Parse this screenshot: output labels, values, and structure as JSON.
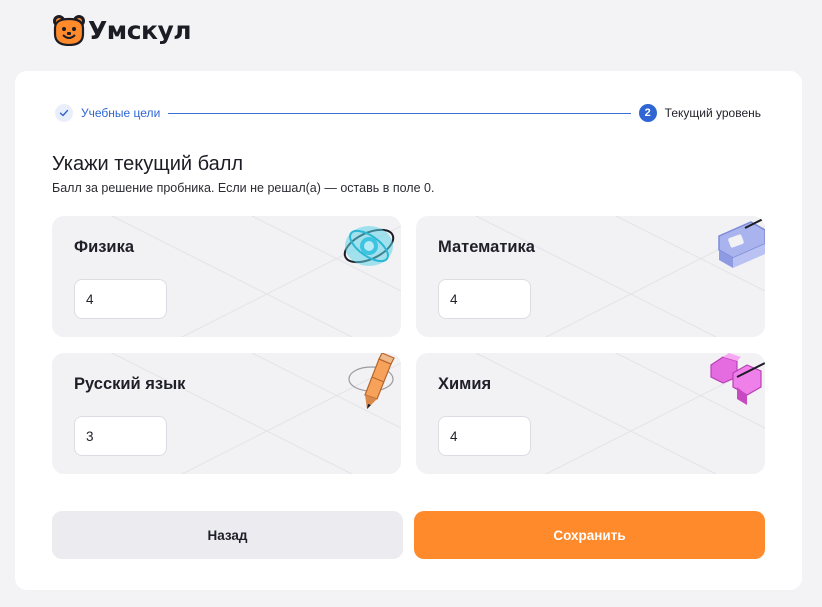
{
  "brand": {
    "name": "Умскул",
    "accent": "#ff8a2b",
    "primary": "#2f66d4"
  },
  "stepper": {
    "steps": [
      {
        "label": "Учебные цели",
        "status": "done",
        "icon": "check-icon"
      },
      {
        "label": "Текущий уровень",
        "status": "active",
        "number": "2"
      }
    ]
  },
  "page": {
    "title": "Укажи текущий балл",
    "subtitle": "Балл за решение пробника. Если не решал(а) — оставь в поле 0."
  },
  "subjects": [
    {
      "name": "Физика",
      "value": "4",
      "icon": "atom-icon"
    },
    {
      "name": "Математика",
      "value": "4",
      "icon": "compass-icon"
    },
    {
      "name": "Русский язык",
      "value": "3",
      "icon": "pencil-icon"
    },
    {
      "name": "Химия",
      "value": "4",
      "icon": "molecule-icon"
    }
  ],
  "actions": {
    "back": "Назад",
    "save": "Сохранить"
  }
}
